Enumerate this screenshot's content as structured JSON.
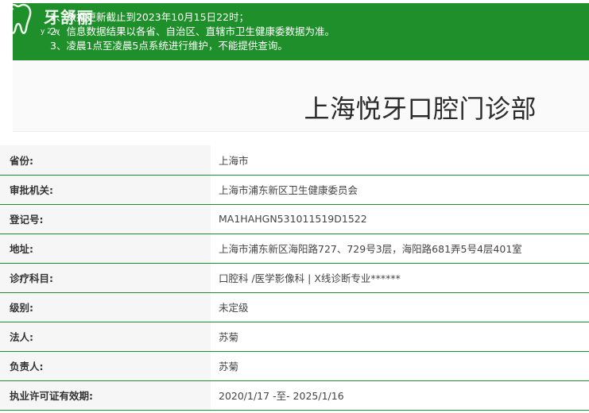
{
  "logo": {
    "name": "牙舒丽",
    "tagline": "y 2 w"
  },
  "notice": {
    "lines": [
      "1、数据更新截止到2023年10月15日22时；",
      "2、信息数据结果以各省、自治区、直辖市卫生健康委数据为准。",
      "3、凌晨1点至凌晨5点系统进行维护，不能提供查询。"
    ]
  },
  "title": "上海悦牙口腔门诊部",
  "info": [
    {
      "label": "省份:",
      "value": "上海市"
    },
    {
      "label": "审批机关:",
      "value": "上海市浦东新区卫生健康委员会"
    },
    {
      "label": "登记号:",
      "value": "MA1HAHGN531011519D1522"
    },
    {
      "label": "地址:",
      "value": "上海市浦东新区海阳路727、729号3层，海阳路681弄5号4层401室"
    },
    {
      "label": "诊疗科目:",
      "value": "口腔科 /医学影像科  |  X线诊断专业******"
    },
    {
      "label": "级别:",
      "value": "未定级"
    },
    {
      "label": "法人:",
      "value": "苏菊"
    },
    {
      "label": "负责人:",
      "value": "苏菊"
    },
    {
      "label": "执业许可证有效期:",
      "value": "2020/1/17 -至- 2025/1/16"
    }
  ],
  "colors": {
    "accent": "#1f8f2b"
  }
}
